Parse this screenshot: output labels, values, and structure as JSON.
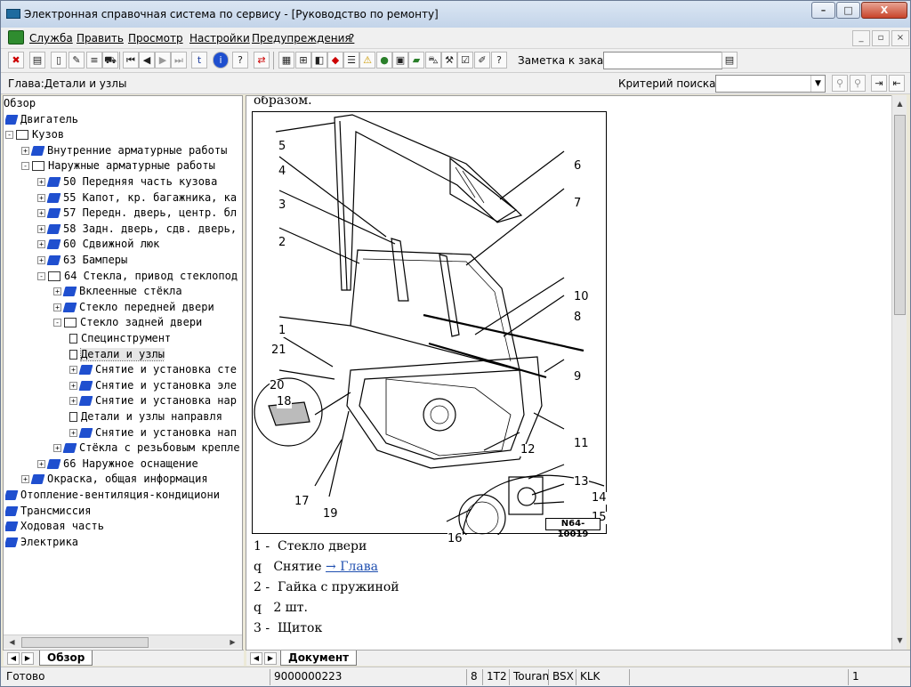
{
  "window": {
    "title": "Электронная справочная система по сервису - [Руководство по ремонту]"
  },
  "menu": {
    "items": [
      "Служба",
      "Править",
      "Просмотр",
      "Настройки",
      "Предупреждения",
      "?"
    ]
  },
  "toolbar": {
    "order_note_label": "Заметка к заказу:",
    "order_note_value": ""
  },
  "subbar": {
    "chapter": "Глава:Детали и узлы",
    "criteria_label": "Критерий поиска:",
    "criteria_value": ""
  },
  "tree": {
    "items": [
      {
        "label": "Обзор",
        "type": "none"
      },
      {
        "label": "Двигатель",
        "type": "book"
      },
      {
        "label": "Кузов",
        "type": "open"
      },
      {
        "label": "Внутренние арматурные работы",
        "type": "book"
      },
      {
        "label": "Наружные арматурные работы",
        "type": "open"
      },
      {
        "label": "50 Передняя часть кузова",
        "type": "book"
      },
      {
        "label": "55 Капот, кр. багажника, ка",
        "type": "book"
      },
      {
        "label": "57 Передн. дверь, центр. бл",
        "type": "book"
      },
      {
        "label": "58 Задн. дверь, сдв. дверь,",
        "type": "book"
      },
      {
        "label": "60 Сдвижной люк",
        "type": "book"
      },
      {
        "label": "63 Бамперы",
        "type": "book"
      },
      {
        "label": "64 Стекла, привод стеклопод",
        "type": "open"
      },
      {
        "label": "Вклеенные стёкла",
        "type": "book"
      },
      {
        "label": "Стекло передней двери",
        "type": "book"
      },
      {
        "label": "Стекло задней двери",
        "type": "open"
      },
      {
        "label": "Специнструмент",
        "type": "doc"
      },
      {
        "label": "Детали и узлы",
        "type": "doc"
      },
      {
        "label": "Снятие и установка сте",
        "type": "book"
      },
      {
        "label": "Снятие и установка эле",
        "type": "book"
      },
      {
        "label": "Снятие и установка нар",
        "type": "book"
      },
      {
        "label": "Детали и узлы направля",
        "type": "doc"
      },
      {
        "label": "Снятие и установка нап",
        "type": "book"
      },
      {
        "label": "Стёкла с резьбовым крепле",
        "type": "book"
      },
      {
        "label": "66 Наружное оснащение",
        "type": "book"
      },
      {
        "label": "Окраска, общая информация",
        "type": "book"
      },
      {
        "label": "Отопление-вентиляция-кондициони",
        "type": "book"
      },
      {
        "label": "Трансмиссия",
        "type": "book"
      },
      {
        "label": "Ходовая часть",
        "type": "book"
      },
      {
        "label": "Электрика",
        "type": "book"
      }
    ]
  },
  "left_tab": {
    "label": "Обзор"
  },
  "document": {
    "top_line": "образом.",
    "figure_code": "N64-10019",
    "callouts": [
      "1",
      "2",
      "3",
      "4",
      "5",
      "6",
      "7",
      "8",
      "9",
      "10",
      "11",
      "12",
      "13",
      "14",
      "15",
      "16",
      "17",
      "18",
      "19",
      "20",
      "21"
    ],
    "lines": [
      {
        "bullet": "1 -",
        "text": "Стекло двери"
      },
      {
        "bullet": "q",
        "text": "Снятие ",
        "link": "→ Глава"
      },
      {
        "bullet": "2 -",
        "text": "Гайка с пружиной"
      },
      {
        "bullet": "q",
        "text": "2 шт."
      },
      {
        "bullet": "3 -",
        "text": "Щиток"
      }
    ]
  },
  "right_tab": {
    "label": "Документ"
  },
  "status": {
    "text": "Готово",
    "code": "9000000223",
    "p1": "8",
    "p2": "1T2",
    "p3": "Touran",
    "p4": "BSX",
    "p5": "KLK",
    "p6": "1"
  }
}
